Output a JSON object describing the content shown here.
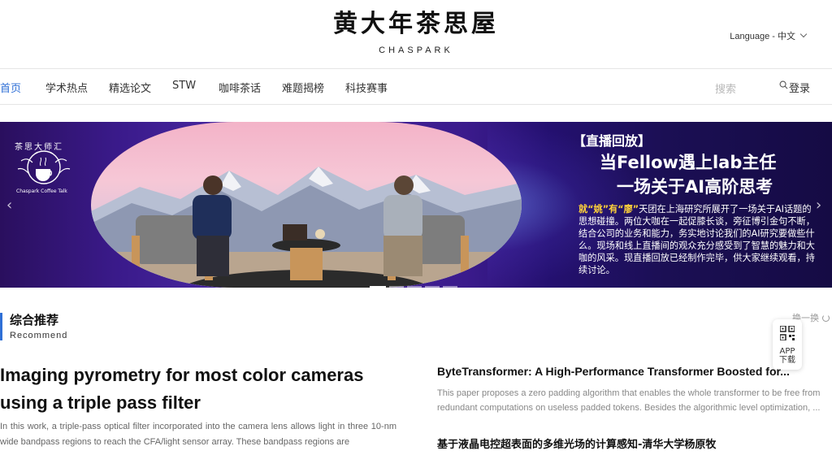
{
  "header": {
    "logo_cn": "黄大年茶思屋",
    "logo_en": "CHASPARK",
    "language_label": "Language - 中文"
  },
  "nav": {
    "items": [
      "首页",
      "学术热点",
      "精选论文",
      "STW",
      "咖啡茶话",
      "难题揭榜",
      "科技赛事"
    ],
    "active_index": 0,
    "search_placeholder": "搜索",
    "login_label": "登录"
  },
  "banner": {
    "badge_text": "茶思大师汇",
    "badge_sub": "Chaspark Coffee Talk",
    "tag": "【直播回放】",
    "title_line1": "当Fellow遇上lab主任",
    "title_line2": "一场关于AI高阶思考",
    "body_highlight": "就“姚”有“廖”",
    "body_text": "天团在上海研究所展开了一场关于AI话题的思想碰撞。两位大咖在一起促膝长谈，旁征博引金句不断，结合公司的业务和能力，务实地讨论我们的AI研究要做些什么。现场和线上直播间的观众充分感受到了智慧的魅力和大咖的风采。现直播回放已经制作完毕，供大家继续观看，持续讨论。",
    "slide_count": 5,
    "active_slide": 0
  },
  "recommend": {
    "title": "综合推荐",
    "subtitle": "Recommend",
    "refresh_label": "换一换",
    "app_label_line1": "APP",
    "app_label_line2": "下载",
    "main_article": {
      "title": "Imaging pyrometry for most color cameras using a triple pass filter",
      "abstract": "In this work, a triple-pass optical filter incorporated into the camera lens allows light in three 10-nm wide bandpass regions to reach the CFA/light sensor array. These bandpass regions are"
    },
    "side_articles": [
      {
        "title": "ByteTransformer: A High-Performance Transformer Boosted for...",
        "abstract": "This paper proposes a zero padding algorithm that enables the whole transformer to be free from redundant computations on useless padded tokens. Besides the algorithmic level optimization, ..."
      },
      {
        "title": "基于液晶电控超表面的多维光场的计算感知-清华大学杨原牧"
      }
    ]
  },
  "colors": {
    "accent": "#2f6fd6",
    "banner_bg": "#2a1470",
    "highlight": "#ffd23a"
  }
}
